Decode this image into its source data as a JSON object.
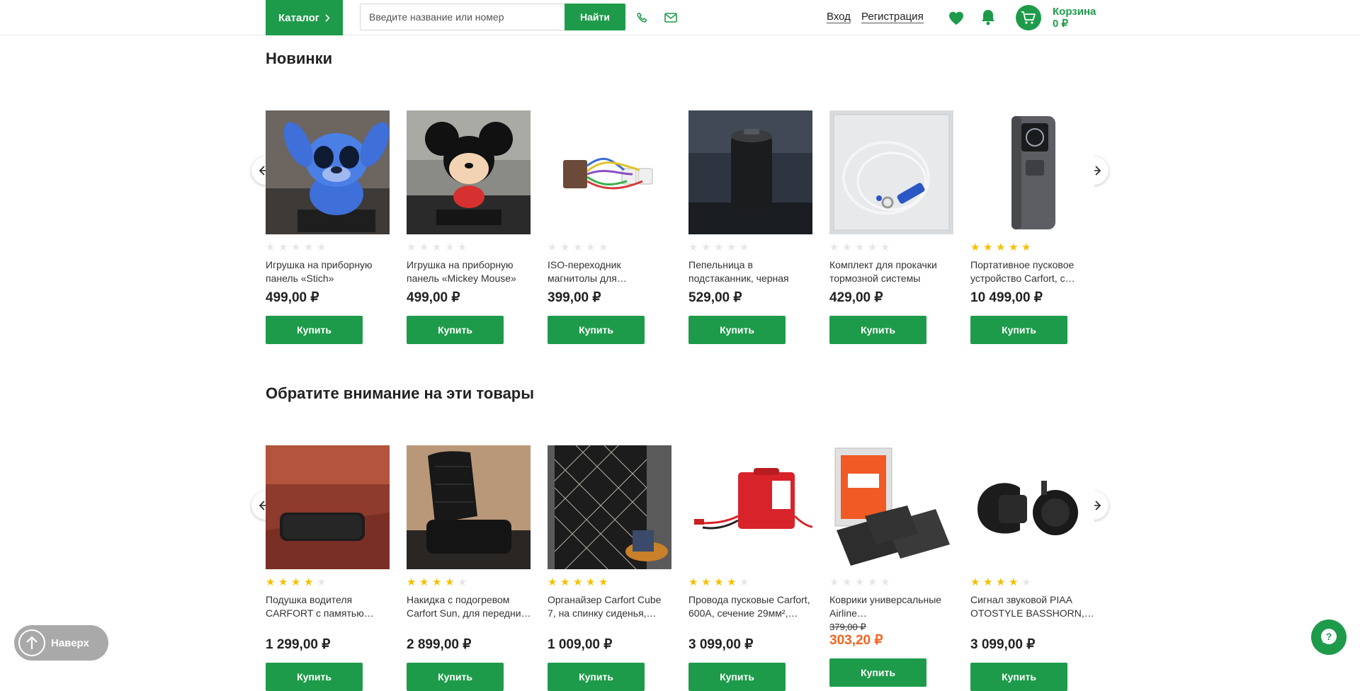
{
  "header": {
    "catalog_label": "Каталог",
    "search_placeholder": "Введите название или номер",
    "search_button": "Найти",
    "login": "Вход",
    "register": "Регистрация",
    "cart_label": "Корзина",
    "cart_total": "0 ₽"
  },
  "colors": {
    "accent": "#1e9b4a",
    "star": "#f5c000",
    "sale_price": "#f26522"
  },
  "sections": {
    "new": {
      "title": "Новинки",
      "products": [
        {
          "title": "Игрушка на приборную панель «Stich»",
          "price": "499,00 ₽",
          "rating": 0,
          "image": "stitch-figure",
          "buy": "Купить"
        },
        {
          "title": "Игрушка на приборную панель «Mickey Mouse»",
          "price": "499,00 ₽",
          "rating": 0,
          "image": "mickey-figure",
          "buy": "Купить"
        },
        {
          "title": "ISO-переходник магнитолы для…",
          "price": "399,00 ₽",
          "rating": 0,
          "image": "iso-adapter",
          "buy": "Купить"
        },
        {
          "title": "Пепельница в подстаканник, черная",
          "price": "529,00 ₽",
          "rating": 0,
          "image": "ashtray",
          "buy": "Купить"
        },
        {
          "title": "Комплект для прокачки тормозной системы",
          "price": "429,00 ₽",
          "rating": 0,
          "image": "brake-bleed-kit",
          "buy": "Купить"
        },
        {
          "title": "Портативное пусковое устройство Carfort, с…",
          "price": "10 499,00 ₽",
          "rating": 5,
          "image": "jump-starter",
          "buy": "Купить"
        }
      ]
    },
    "attention": {
      "title": "Обратите внимание на эти товары",
      "products": [
        {
          "title": "Подушка водителя CARFORT с памятью…",
          "price": "1 299,00 ₽",
          "old_price": "",
          "rating": 4,
          "image": "seat-cushion",
          "buy": "Купить"
        },
        {
          "title": "Накидка с подогревом Carfort Sun, для передни…",
          "price": "2 899,00 ₽",
          "old_price": "",
          "rating": 4,
          "image": "heated-seat-cover",
          "buy": "Купить"
        },
        {
          "title": "Органайзер Carfort Cube 7, на спинку сиденья,…",
          "price": "1 009,00 ₽",
          "old_price": "",
          "rating": 5,
          "image": "seat-organizer",
          "buy": "Купить"
        },
        {
          "title": "Провода пусковые Carfort, 600А, сечение 29мм²,…",
          "price": "3 099,00 ₽",
          "old_price": "",
          "rating": 4,
          "image": "jumper-cables",
          "buy": "Купить"
        },
        {
          "title": "Коврики универсальные Airline…",
          "price": "303,20 ₽",
          "old_price": "379,00 ₽",
          "rating": 0,
          "image": "floor-mats",
          "buy": "Купить"
        },
        {
          "title": "Сигнал звуковой PIAA OTOSTYLE BASSHORN,…",
          "price": "3 099,00 ₽",
          "old_price": "",
          "rating": 4,
          "image": "horn",
          "buy": "Купить"
        }
      ]
    }
  },
  "to_top_label": "Наверх"
}
